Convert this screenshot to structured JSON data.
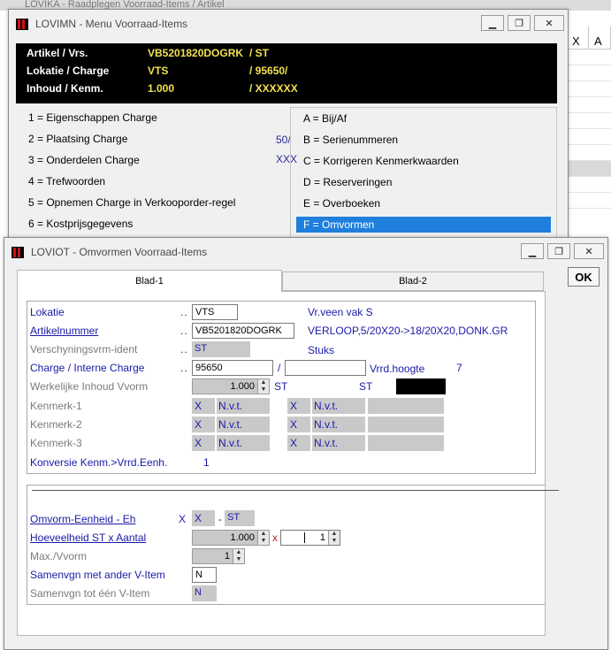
{
  "background": {
    "title_fragment": "LOVIKA - Raadplegen Voorraad-Items / Artikel",
    "grid_headers": [
      "X",
      "A"
    ]
  },
  "menu_window": {
    "title": "LOVIMN - Menu Voorraad-Items",
    "info": [
      {
        "label": "Artikel / Vrs.",
        "value1": "VB5201820DOGRK",
        "value2": "/ ST"
      },
      {
        "label": "Lokatie / Charge",
        "value1": "VTS",
        "value2": "/ 95650/"
      },
      {
        "label": "Inhoud  / Kenm.",
        "value1": "1.000",
        "value2": "/ XXXXXX"
      }
    ],
    "left_items": [
      "1 = Eigenschappen Charge",
      "2 = Plaatsing    Charge",
      "3 = Onderdelen    Charge",
      "4 = Trefwoorden",
      "5 = Opnemen Charge in Verkooporder-regel",
      "6 = Kostprijsgegevens"
    ],
    "right_items": [
      "A = Bij/Af",
      "B = Serienummeren",
      "C = Korrigeren Kenmerkwaarden",
      "D = Reserveringen",
      "E = Overboeken",
      "F = Omvormen"
    ],
    "selected_right_index": 5,
    "mid_values": [
      "50/",
      "XXX"
    ]
  },
  "dialog": {
    "title": "LOVIOT - Omvormen Voorraad-Items",
    "ok_label": "OK",
    "tabs": [
      "Blad-1",
      "Blad-2"
    ],
    "fields": {
      "lokatie": {
        "label": "Lokatie",
        "value": "VTS",
        "desc": "Vr.veen vak S"
      },
      "artikelnummer": {
        "label": "Artikelnummer",
        "value": "VB5201820DOGRK",
        "desc": "VERLOOP,5/20X20->18/20X20,DONK.GR"
      },
      "verschijningsvorm": {
        "label": "Verschyningsvrm-ident",
        "value": "ST",
        "desc": "Stuks"
      },
      "charge": {
        "label": "Charge / Interne Charge",
        "value": "95650",
        "slash": "/",
        "interne": "",
        "vrrd_label": "Vrrd.hoogte",
        "vrrd_value": "7"
      },
      "inhoud": {
        "label": "Werkelijke Inhoud Vvorm",
        "value": "1.000",
        "unit": "ST",
        "unit2": "ST"
      },
      "kenmerken": [
        {
          "label": "Kenmerk-1",
          "x1": "X",
          "n1": "N.v.t.",
          "x2": "X",
          "n2": "N.v.t."
        },
        {
          "label": "Kenmerk-2",
          "x1": "X",
          "n1": "N.v.t.",
          "x2": "X",
          "n2": "N.v.t."
        },
        {
          "label": "Kenmerk-3",
          "x1": "X",
          "n1": "N.v.t.",
          "x2": "X",
          "n2": "N.v.t."
        }
      ],
      "konversie": {
        "label": "Konversie Kenm.>Vrrd.Eenh.",
        "value": "1"
      },
      "omvorm_eenheid": {
        "label": "Omvorm-Eenheid - Eh",
        "x": "X",
        "box": "X",
        "dash": "-",
        "unit": "ST"
      },
      "hoeveelheid": {
        "label": "Hoeveelheid ST x Aantal",
        "value": "1.000",
        "x": "x",
        "aantal": "1"
      },
      "max_vvorm": {
        "label": "Max./Vvorm",
        "value": "1"
      },
      "samenvgn_ander": {
        "label": "Samenvgn met ander V-Item",
        "value": "N"
      },
      "samenvgn_een": {
        "label": "Samenvgn tot één V-Item",
        "value": "N"
      }
    }
  }
}
